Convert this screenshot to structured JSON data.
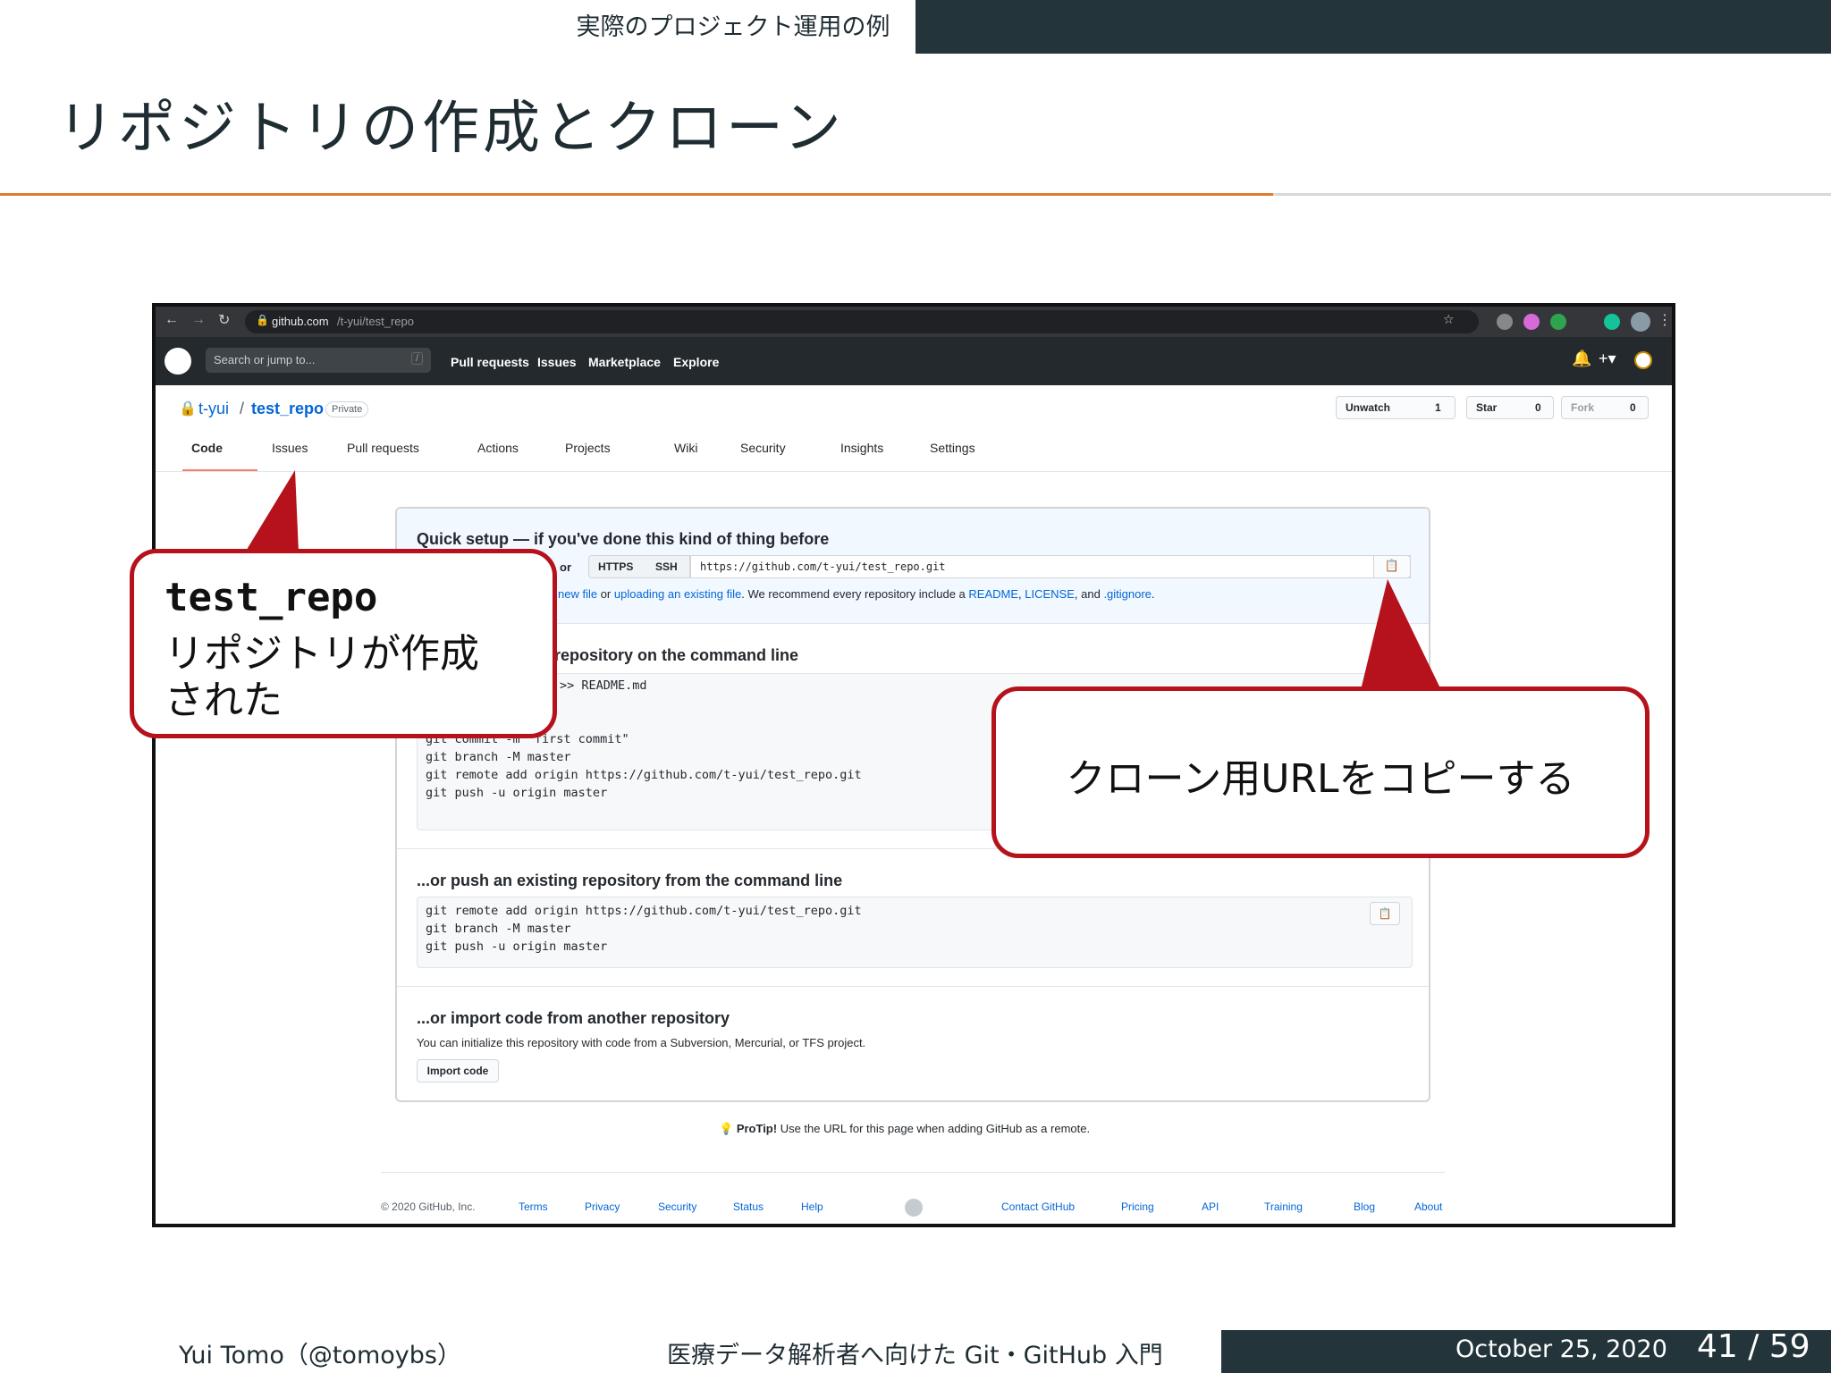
{
  "slide": {
    "section": "実際のプロジェクト運用の例",
    "title": "リポジトリの作成とクローン",
    "footer_author": "Yui Tomo（@tomoybs）",
    "footer_course": "医療データ解析者へ向けた Git・GitHub 入門",
    "footer_date": "October 25, 2020",
    "page_current": "41",
    "page_sep": "/",
    "page_total": "59"
  },
  "browser": {
    "url_domain": "github.com",
    "url_path": "/t-yui/test_repo"
  },
  "github": {
    "search_placeholder": "Search or jump to...",
    "search_key": "/",
    "nav": [
      "Pull requests",
      "Issues",
      "Marketplace",
      "Explore"
    ],
    "owner": "t-yui",
    "slash": "/",
    "repo": "test_repo",
    "visibility": "Private",
    "unwatch_label": "Unwatch",
    "unwatch_count": "1",
    "star_label": "Star",
    "star_count": "0",
    "fork_label": "Fork",
    "fork_count": "0",
    "tabs": [
      "Code",
      "Issues",
      "Pull requests",
      "Actions",
      "Projects",
      "Wiki",
      "Security",
      "Insights",
      "Settings"
    ],
    "quick_setup_title": "Quick setup — if you've done this kind of thing before",
    "or_text": "or",
    "proto_https": "HTTPS",
    "proto_ssh": "SSH",
    "clone_url": "https://github.com/t-yui/test_repo.git",
    "hint_prefix": "new file",
    "hint_or": "or",
    "hint_upload": "uploading an existing file",
    "hint_recommend": ". We recommend every repository include a",
    "hint_readme": "README",
    "hint_license": "LICENSE",
    "hint_and": ", and",
    "hint_gitignore": ".gitignore",
    "create_title": "repository on the command line",
    "create_code_line1": ">> README.md",
    "create_code": "git commit -m \"first commit\"\ngit branch -M master\ngit remote add origin https://github.com/t-yui/test_repo.git\ngit push -u origin master",
    "push_title": "...or push an existing repository from the command line",
    "push_code": "git remote add origin https://github.com/t-yui/test_repo.git\ngit branch -M master\ngit push -u origin master",
    "import_title": "...or import code from another repository",
    "import_desc": "You can initialize this repository with code from a Subversion, Mercurial, or TFS project.",
    "import_button": "Import code",
    "protip_bold": "ProTip!",
    "protip_text": "Use the URL for this page when adding GitHub as a remote.",
    "footer_copy": "© 2020 GitHub, Inc.",
    "footer_left_links": [
      "Terms",
      "Privacy",
      "Security",
      "Status",
      "Help"
    ],
    "footer_right_links": [
      "Contact GitHub",
      "Pricing",
      "API",
      "Training",
      "Blog",
      "About"
    ]
  },
  "callouts": {
    "left_line1": "test_repo",
    "left_line2": "リポジトリが作成",
    "left_line3": "された",
    "right_text": "クローン用URLをコピーする",
    "color": "#b5121b"
  }
}
